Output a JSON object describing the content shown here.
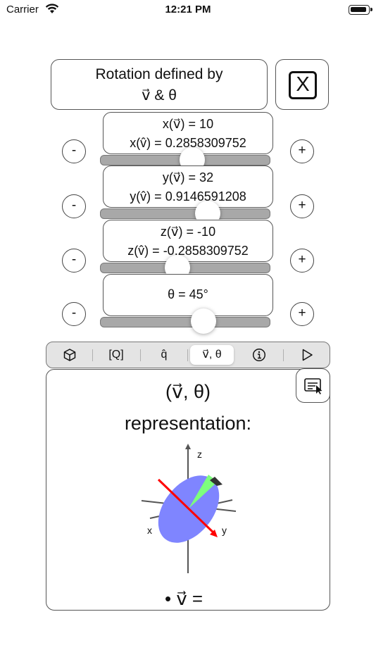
{
  "status_bar": {
    "carrier": "Carrier",
    "time": "12:21 PM"
  },
  "header": {
    "title_line1": "Rotation defined by",
    "title_line2": "v⃗ & θ",
    "close_label": "X"
  },
  "rows": [
    {
      "line1": "x(v⃗) = 10",
      "line2": "x(v̂) = 0.2858309752",
      "minus": "-",
      "plus": "+",
      "slider_fraction": 0.55
    },
    {
      "line1": "y(v⃗) = 32",
      "line2": "y(v̂) = 0.9146591208",
      "minus": "-",
      "plus": "+",
      "slider_fraction": 0.64
    },
    {
      "line1": "z(v⃗) = -10",
      "line2": "z(v̂) = -0.2858309752",
      "minus": "-",
      "plus": "+",
      "slider_fraction": 0.45
    },
    {
      "line1": "θ = 45°",
      "minus": "-",
      "plus": "+",
      "slider_fraction": 0.62
    }
  ],
  "tabs": [
    {
      "label": "",
      "icon": "cube-icon"
    },
    {
      "label": "[Q]"
    },
    {
      "label": "q̂"
    },
    {
      "label": "v⃗, θ",
      "active": true
    },
    {
      "label": "",
      "icon": "info-icon"
    },
    {
      "label": "",
      "icon": "play-icon"
    }
  ],
  "panel": {
    "title_line1": "(v⃗, θ)",
    "title_line2": "representation:",
    "axis_z": "z",
    "axis_x": "x",
    "axis_y": "y",
    "bullet": "• v⃗ =",
    "disc_color": "#7f85ff",
    "wedge_color": "#7dff7d",
    "vector_color": "#ff0000"
  }
}
